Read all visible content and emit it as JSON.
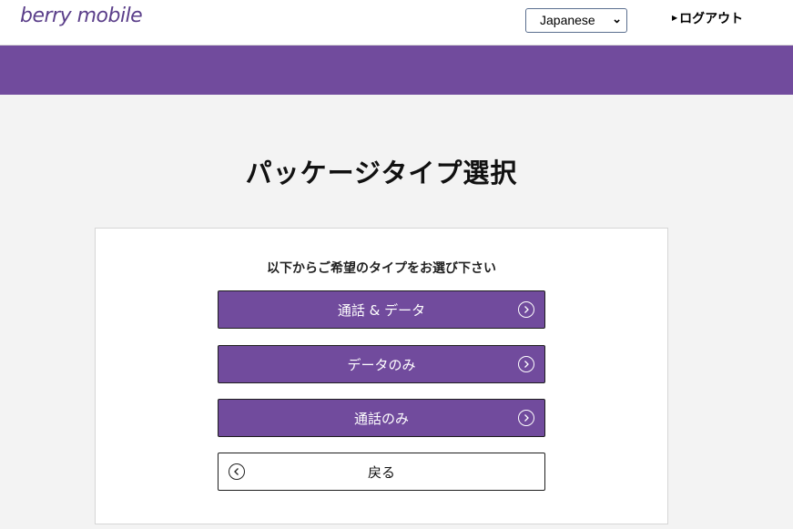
{
  "header": {
    "logo_text": "berry mobile",
    "language_select": {
      "selected": "Japanese"
    },
    "logout_label": "ログアウト"
  },
  "main": {
    "title": "パッケージタイプ選択",
    "instruction": "以下からご希望のタイプをお選び下さい",
    "options": [
      {
        "label": "通話 & データ",
        "icon": "chevron-right-circle-icon"
      },
      {
        "label": "データのみ",
        "icon": "chevron-right-circle-icon"
      },
      {
        "label": "通話のみ",
        "icon": "chevron-right-circle-icon"
      }
    ],
    "back_label": "戻る",
    "back_icon": "chevron-left-circle-icon"
  },
  "colors": {
    "brand_purple": "#714b9d",
    "logo_purple": "#5b3f8a",
    "page_background": "#f3f3f3"
  }
}
